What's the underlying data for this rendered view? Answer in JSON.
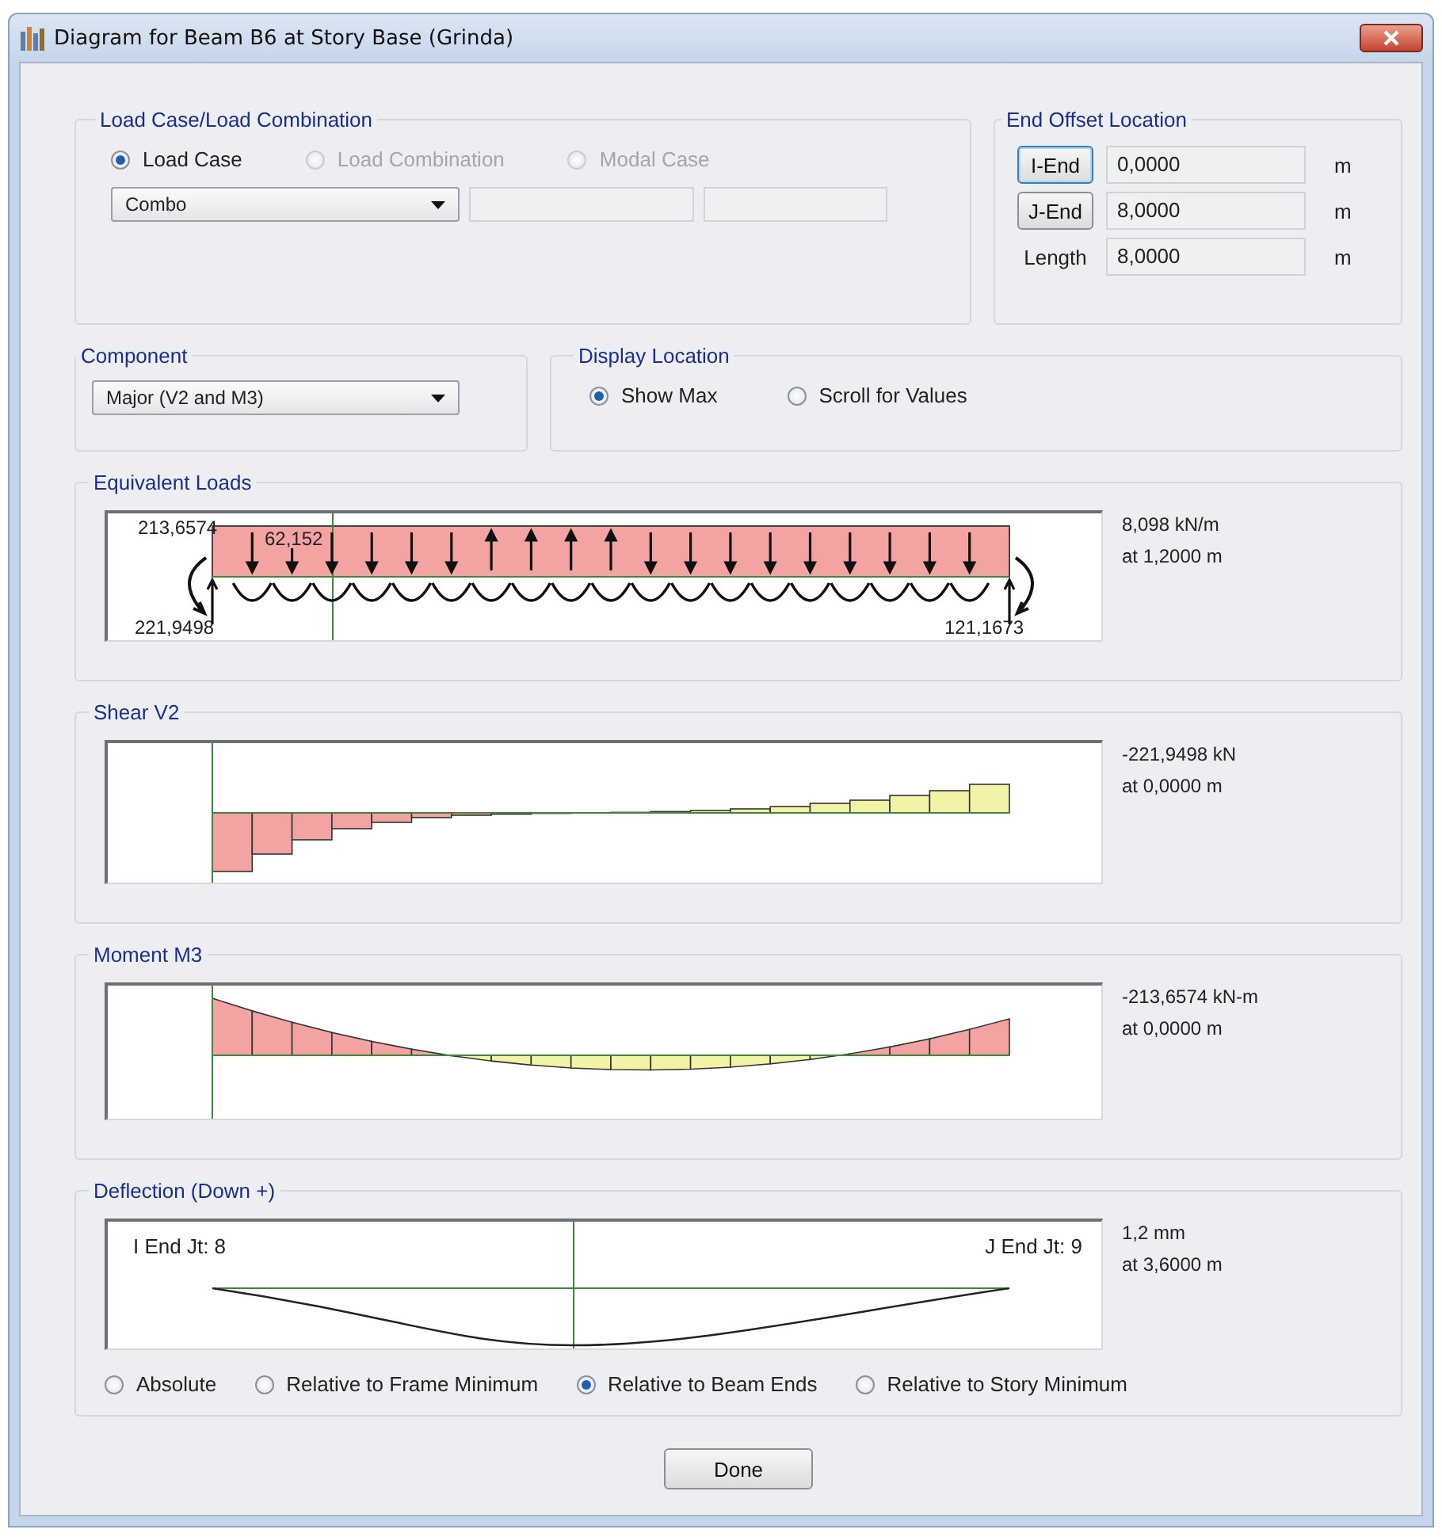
{
  "window": {
    "title": "Diagram for Beam B6 at Story Base (Grinda)"
  },
  "load_case": {
    "title": "Load Case/Load Combination",
    "options": [
      {
        "label": "Load Case",
        "selected": true,
        "disabled": false
      },
      {
        "label": "Load Combination",
        "selected": false,
        "disabled": true
      },
      {
        "label": "Modal Case",
        "selected": false,
        "disabled": true
      }
    ],
    "dropdown": {
      "value": "Combo"
    }
  },
  "end_offset": {
    "title": "End Offset Location",
    "rows": [
      {
        "kind": "button",
        "label": "I-End",
        "focused": true,
        "value": "0,0000",
        "unit": "m"
      },
      {
        "kind": "button",
        "label": "J-End",
        "focused": false,
        "value": "8,0000",
        "unit": "m"
      },
      {
        "kind": "text",
        "label": "Length",
        "value": "8,0000",
        "unit": "m"
      }
    ]
  },
  "component": {
    "title": "Component",
    "dropdown": {
      "value": "Major (V2 and M3)"
    }
  },
  "display_location": {
    "title": "Display Location",
    "options": [
      {
        "label": "Show Max",
        "selected": true
      },
      {
        "label": "Scroll for Values",
        "selected": false
      }
    ]
  },
  "diagrams": [
    {
      "kind": "loads",
      "title": "Equivalent Loads",
      "labels": [
        "213,6574",
        "62,152",
        "221,9498",
        "121,1673"
      ],
      "max": "8,098 kN/m",
      "at": "at 1,2000 m"
    },
    {
      "kind": "shear",
      "title": "Shear V2",
      "max": "-221,9498 kN",
      "at": "at 0,0000 m"
    },
    {
      "kind": "moment",
      "title": "Moment M3",
      "max": "-213,6574 kN-m",
      "at": "at 0,0000 m"
    },
    {
      "kind": "deflection",
      "title": "Deflection (Down +)",
      "labels": [
        "I End Jt: 8",
        "J End Jt: 9"
      ],
      "max": "1,2 mm",
      "at": "at 3,6000 m",
      "options": [
        {
          "label": "Absolute",
          "selected": false
        },
        {
          "label": "Relative to Frame Minimum",
          "selected": false
        },
        {
          "label": "Relative to Beam Ends",
          "selected": true
        },
        {
          "label": "Relative to Story Minimum",
          "selected": false
        }
      ]
    }
  ],
  "buttons": [
    "Done"
  ]
}
